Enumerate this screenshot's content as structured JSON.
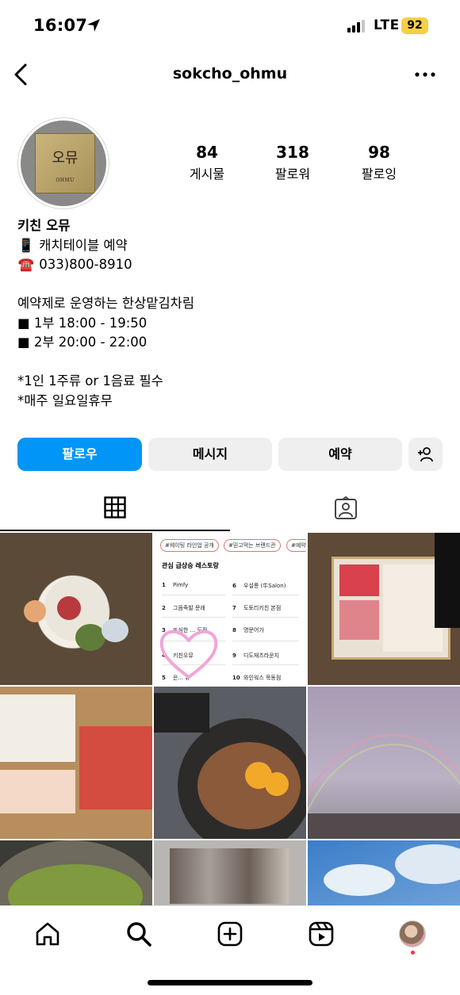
{
  "status_bar": {
    "time": "16:07",
    "network": "LTE",
    "battery": "92"
  },
  "header": {
    "username": "sokcho_ohmu"
  },
  "profile": {
    "avatar_sign_kr": "오뮤",
    "avatar_sign_en": "OHMU",
    "stats": [
      {
        "value": "84",
        "label": "게시물"
      },
      {
        "value": "318",
        "label": "팔로워"
      },
      {
        "value": "98",
        "label": "팔로잉"
      }
    ],
    "name": "키친 오뮤",
    "bio_lines": [
      {
        "icon": "📱",
        "text": "캐치테이블 예약"
      },
      {
        "icon": "☎️",
        "text": "033)800-8910"
      },
      {
        "icon": "",
        "text": ""
      },
      {
        "icon": "",
        "text": "예약제로 운영하는 한상맡김차림"
      },
      {
        "icon": "",
        "text": "■ 1부 18:00 - 19:50"
      },
      {
        "icon": "",
        "text": "■ 2부 20:00 - 22:00"
      },
      {
        "icon": "",
        "text": ""
      },
      {
        "icon": "",
        "text": "*1인 1주류 or 1음료 필수"
      },
      {
        "icon": "",
        "text": "*매주 일요일휴무"
      }
    ]
  },
  "actions": {
    "follow": "팔로우",
    "message": "메시지",
    "reserve": "예약"
  },
  "post_ranking": {
    "chips": [
      "#웨이팅 라인업 공개",
      "#믿고먹는 브랜드관",
      "#예약"
    ],
    "title": "관심 급상승 레스토랑",
    "left": [
      {
        "rank": "1",
        "name": "Pimfy"
      },
      {
        "rank": "2",
        "name": "그믐족발 문래"
      },
      {
        "rank": "3",
        "name": "뜨심한 ... 도점"
      },
      {
        "rank": "4",
        "name": "키친오뮤"
      },
      {
        "rank": "5",
        "name": "은... 유"
      }
    ],
    "right": [
      {
        "rank": "6",
        "name": "우설롱 (牛Salon)"
      },
      {
        "rank": "7",
        "name": "도토리키친 본점"
      },
      {
        "rank": "8",
        "name": "명문어가"
      },
      {
        "rank": "9",
        "name": "디도재즈라운지"
      },
      {
        "rank": "10",
        "name": "와인웍스 목동점"
      }
    ]
  },
  "colors": {
    "accent": "#0095f6",
    "button_bg": "#efefef",
    "badge": "#f7cf45",
    "heart": "#f2a4d8"
  },
  "icons": {
    "back": "chevron-left-icon",
    "more": "more-horizontal-icon",
    "add_user": "add-person-icon",
    "grid": "grid-icon",
    "tagged": "tagged-person-icon",
    "home": "home-icon",
    "search": "search-icon",
    "create": "plus-square-icon",
    "reels": "reels-icon"
  }
}
